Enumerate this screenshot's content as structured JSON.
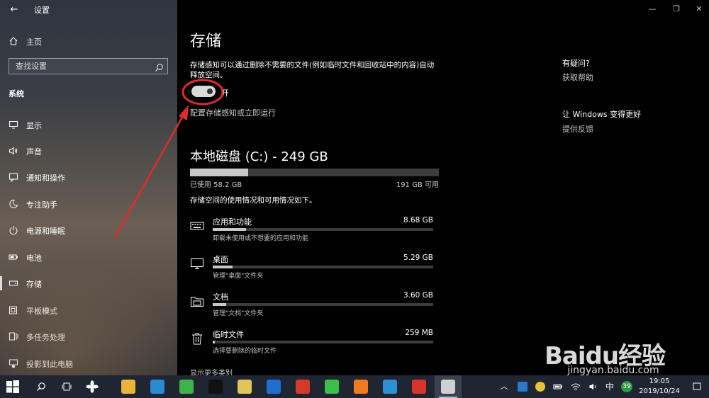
{
  "window": {
    "title": "设置",
    "back": "←",
    "min": "—",
    "max": "❐",
    "close": "✕"
  },
  "sidebar": {
    "home": {
      "label": "主页",
      "icon": "home-icon"
    },
    "search": {
      "placeholder": "查找设置",
      "icon": "search-icon"
    },
    "section": "系统",
    "items": [
      {
        "label": "显示",
        "icon": "display-icon",
        "selected": false
      },
      {
        "label": "声音",
        "icon": "speaker-icon",
        "selected": false
      },
      {
        "label": "通知和操作",
        "icon": "notification-icon",
        "selected": false
      },
      {
        "label": "专注助手",
        "icon": "moon-icon",
        "selected": false
      },
      {
        "label": "电源和睡眠",
        "icon": "power-icon",
        "selected": false
      },
      {
        "label": "电池",
        "icon": "battery-icon",
        "selected": false
      },
      {
        "label": "存储",
        "icon": "storage-icon",
        "selected": true
      },
      {
        "label": "平板模式",
        "icon": "tablet-icon",
        "selected": false
      },
      {
        "label": "多任务处理",
        "icon": "multitask-icon",
        "selected": false
      },
      {
        "label": "投影到此电脑",
        "icon": "project-icon",
        "selected": false
      }
    ]
  },
  "main": {
    "title": "存储",
    "description": "存储感知可以通过删除不需要的文件(例如临时文件和回收站中的内容)自动释放空间。",
    "toggle": {
      "state": "开",
      "on": true
    },
    "config_link": "配置存储感知或立即运行",
    "disk": {
      "title": "本地磁盘 (C:) - 249 GB",
      "used_fraction": 0.234,
      "used_label": "已使用 58.2 GB",
      "free_label": "191 GB 可用"
    },
    "usage_description": "存储空间的使用情况和可用情况如下。",
    "categories": [
      {
        "name": "应用和功能",
        "size": "8.68 GB",
        "fraction": 0.15,
        "desc": "卸载未使用或不想要的应用和功能",
        "icon": "keyboard-icon"
      },
      {
        "name": "桌面",
        "size": "5.29 GB",
        "fraction": 0.09,
        "desc": "管理\"桌面\"文件夹",
        "icon": "monitor-icon"
      },
      {
        "name": "文档",
        "size": "3.60 GB",
        "fraction": 0.06,
        "desc": "管理\"文档\"文件夹",
        "icon": "documents-icon"
      },
      {
        "name": "临时文件",
        "size": "259 MB",
        "fraction": 0.01,
        "desc": "选择要删除的临时文件",
        "icon": "trash-icon"
      }
    ],
    "show_more": "显示更多类别"
  },
  "right": {
    "question": "有疑问?",
    "get_help": "获取帮助",
    "improve": "让 Windows 变得更好",
    "feedback": "提供反馈"
  },
  "taskbar": {
    "apps": [
      {
        "name": "file-explorer-icon",
        "color": "#e8b43a"
      },
      {
        "name": "store-icon",
        "color": "#2a8ad4"
      },
      {
        "name": "browser-icon",
        "color": "#3db34a"
      },
      {
        "name": "qq-icon",
        "color": "#111111"
      },
      {
        "name": "app-yellow-icon",
        "color": "#e2c45a"
      },
      {
        "name": "app-blue-icon",
        "color": "#1f6fd0"
      },
      {
        "name": "app-red-icon",
        "color": "#d23a2a"
      },
      {
        "name": "wechat-icon",
        "color": "#3cbf4a"
      },
      {
        "name": "app-orange-icon",
        "color": "#f07a1e"
      },
      {
        "name": "app-penguin-icon",
        "color": "#2d8fd6"
      },
      {
        "name": "app-power-icon",
        "color": "#d9342b"
      },
      {
        "name": "settings-icon",
        "color": "#d0d0d0"
      }
    ],
    "ime": "中",
    "badge": "39",
    "time": "19:05",
    "date": "2019/10/24"
  },
  "watermark": {
    "brand": "Baidu经验",
    "url": "jingyan.baidu.com"
  },
  "colors": {
    "accent": "#e02b2b",
    "sidebar": "#3a3d45",
    "main_bg": "#000000",
    "taskbar": "#1f2531"
  }
}
